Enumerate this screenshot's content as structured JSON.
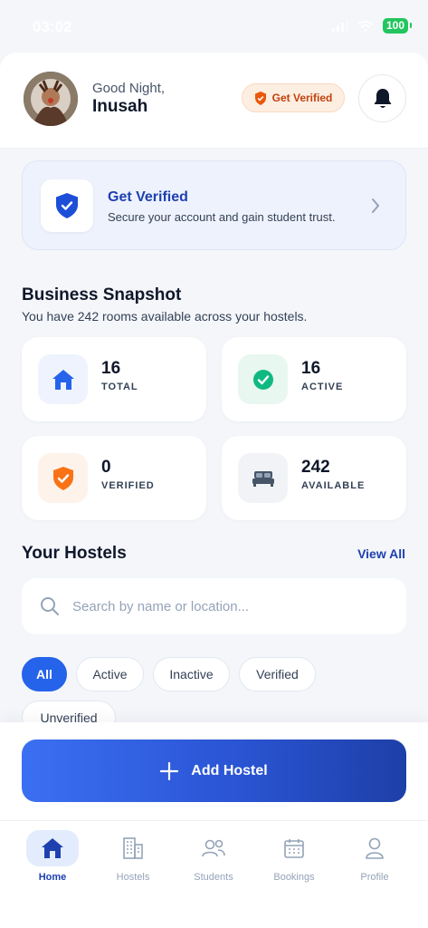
{
  "status_bar": {
    "time": "03:02",
    "battery": "100"
  },
  "header": {
    "greeting": "Good Night,",
    "user_name": "Inusah",
    "verify_pill_label": "Get Verified"
  },
  "verify_card": {
    "title": "Get Verified",
    "subtitle": "Secure your account and gain student trust."
  },
  "snapshot": {
    "title": "Business Snapshot",
    "subtitle": "You have 242 rooms available across your hostels.",
    "stats": [
      {
        "value": "16",
        "label": "TOTAL",
        "icon": "home-icon",
        "color": "#2563eb"
      },
      {
        "value": "16",
        "label": "ACTIVE",
        "icon": "check-circle-icon",
        "color": "#10b981"
      },
      {
        "value": "0",
        "label": "VERIFIED",
        "icon": "shield-check-icon",
        "color": "#f97316"
      },
      {
        "value": "242",
        "label": "AVAILABLE",
        "icon": "bed-icon",
        "color": "#475569"
      }
    ]
  },
  "hostels": {
    "title": "Your Hostels",
    "view_all": "View All",
    "search_placeholder": "Search by name or location...",
    "filters": [
      "All",
      "Active",
      "Inactive",
      "Verified",
      "Unverified"
    ],
    "active_filter": "All"
  },
  "add_button_label": "Add Hostel",
  "nav": {
    "items": [
      {
        "label": "Home",
        "icon": "home-icon"
      },
      {
        "label": "Hostels",
        "icon": "building-icon"
      },
      {
        "label": "Students",
        "icon": "users-icon"
      },
      {
        "label": "Bookings",
        "icon": "calendar-icon"
      },
      {
        "label": "Profile",
        "icon": "user-icon"
      }
    ],
    "active": "Home"
  },
  "colors": {
    "primary": "#2563eb",
    "primary_dark": "#1e40af",
    "success": "#10b981",
    "warning": "#f97316",
    "background": "#f4f6fa"
  }
}
